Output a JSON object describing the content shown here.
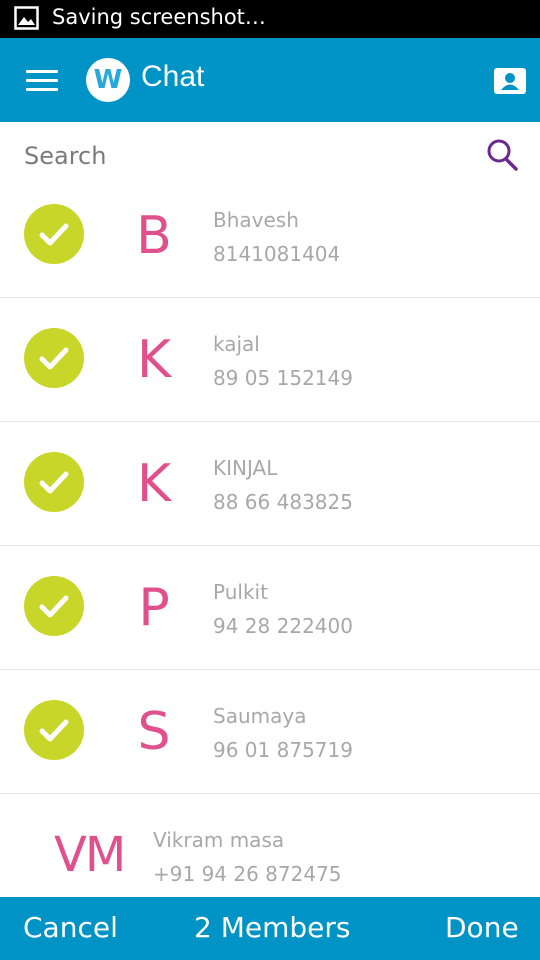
{
  "status_bar": {
    "text": "Saving screenshot…",
    "icon": "image-icon"
  },
  "app_bar": {
    "title": "Chat",
    "logo_letter": "W",
    "menu_icon": "hamburger-menu-icon",
    "contact_icon": "contact-card-icon"
  },
  "search": {
    "placeholder": "Search",
    "icon": "search-icon"
  },
  "contacts": [
    {
      "initial": "B",
      "name": "Bhavesh",
      "phone": "8141081404",
      "selected": true
    },
    {
      "initial": "K",
      "name": "kajal",
      "phone": "89 05 152149",
      "selected": true
    },
    {
      "initial": "K",
      "name": "KINJAL",
      "phone": "88 66 483825",
      "selected": true
    },
    {
      "initial": "P",
      "name": "Pulkit",
      "phone": "94 28 222400",
      "selected": true
    },
    {
      "initial": "S",
      "name": "Saumaya",
      "phone": "96 01 875719",
      "selected": true
    },
    {
      "initial": "VM",
      "name": "Vikram masa",
      "phone": "+91 94 26 872475",
      "selected": false
    }
  ],
  "bottom_bar": {
    "cancel": "Cancel",
    "members": "2 Members",
    "done": "Done"
  },
  "colors": {
    "primary": "#0093c6",
    "check": "#c8d62a",
    "initial": "#e0508c",
    "text_muted": "#a8a8a8"
  }
}
